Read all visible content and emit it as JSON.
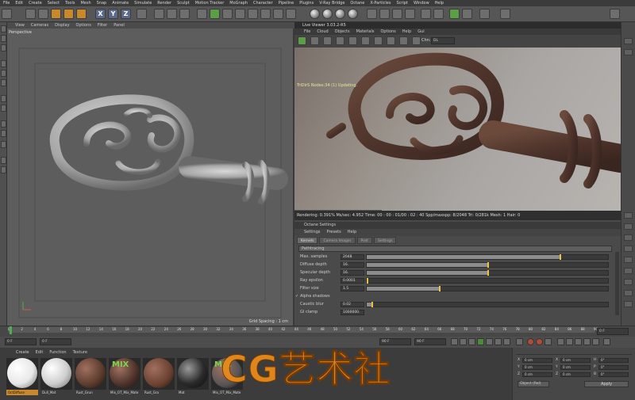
{
  "menubar": [
    "File",
    "Edit",
    "Create",
    "Select",
    "Tools",
    "Mesh",
    "Snap",
    "Animate",
    "Simulate",
    "Render",
    "Sculpt",
    "Motion Tracker",
    "MoGraph",
    "Character",
    "Pipeline",
    "Plugins",
    "V-Ray Bridge",
    "Octane",
    "X-Particles",
    "Script",
    "Window",
    "Help"
  ],
  "toolbar": {
    "x_label": "X",
    "y_label": "Y",
    "z_label": "Z"
  },
  "viewport": {
    "menu": [
      "View",
      "Cameras",
      "Display",
      "Options",
      "Filter",
      "Panel"
    ],
    "label": "Perspective",
    "grid_spacing": "Grid Spacing : 1 cm"
  },
  "liveviewer": {
    "title": "Live Viewer 3.03.2-R5",
    "menu": [
      "File",
      "Cloud",
      "Objects",
      "Materials",
      "Options",
      "Help",
      "Gui"
    ],
    "channel_label": "Chn:",
    "channel_value": "DL",
    "status": "TriDirS Nodes:34 (1) Updating.",
    "gpu": {
      "name": "GTX 980M[T1]",
      "mem": "9/80",
      "temp": "64°C",
      "line1": "Out-of-core used/max:0Kb/4Gb",
      "line2": "Grey8/16: 2/0",
      "line2b": "Rgb32/64: 0/1",
      "line3": "Used/free/total vram: 748Mb/721Mb/2Gb"
    },
    "gpu_buttons": [
      "Light",
      "DIFF"
    ],
    "statusbar": "Rendering: 0.391%    Ms/sec: 4.952    Time: 00 : 00 : 01/00 : 02 : 40    Spp/maxspp: 8/2048    Tri: 0/281k    Mesh: 1    Hair: 0"
  },
  "octane": {
    "title": "Octane Settings",
    "menu": [
      "Settings",
      "Presets",
      "Help"
    ],
    "tabs": [
      "Kernels",
      "Camera Imager",
      "Post",
      "Settings"
    ],
    "kernel": "Pathtracing",
    "params": [
      {
        "label": "Max. samples",
        "value": "2048",
        "fill": 0.8
      },
      {
        "label": "Diffuse depth",
        "value": "16.",
        "fill": 0.5
      },
      {
        "label": "Specular depth",
        "value": "16.",
        "fill": 0.5
      },
      {
        "label": "Ray epsilon",
        "value": "0.0001",
        "fill": 0.0
      },
      {
        "label": "Filter size",
        "value": "1.5",
        "fill": 0.3
      },
      {
        "label": "Alpha shadows",
        "value": "",
        "fill": -1
      },
      {
        "label": "Caustic blur",
        "value": "0.02",
        "fill": 0.02
      },
      {
        "label": "GI clamp",
        "value": "1000000.",
        "fill": -1
      }
    ]
  },
  "timeline": {
    "ticks": [
      "0",
      "2",
      "4",
      "6",
      "8",
      "10",
      "12",
      "14",
      "16",
      "18",
      "20",
      "22",
      "24",
      "26",
      "28",
      "30",
      "32",
      "34",
      "36",
      "38",
      "40",
      "42",
      "44",
      "46",
      "48",
      "50",
      "52",
      "54",
      "56",
      "58",
      "60",
      "62",
      "64",
      "66",
      "68",
      "70",
      "72",
      "74",
      "76",
      "78",
      "80",
      "82",
      "84",
      "86",
      "88",
      "90"
    ],
    "frame_end": "0 F",
    "start_field": "0 F",
    "field2": "0 F",
    "field3": "90 F",
    "field4": "90 F"
  },
  "materials": {
    "menu": [
      "Create",
      "Edit",
      "Function",
      "Texture"
    ],
    "items": [
      {
        "name": "OctDiffuse",
        "color": "#e8e8e8",
        "type": "white",
        "selected": true
      },
      {
        "name": "Dull_Mat",
        "color": "#cfcfcf",
        "type": "white",
        "selected": false
      },
      {
        "name": "Rust_Grun",
        "color": "#5a3a2c",
        "type": "rust",
        "selected": false
      },
      {
        "name": "Mix_OT_Mix_Mate",
        "color": "#4a3028",
        "type": "mix",
        "selected": false
      },
      {
        "name": "Rust_Gra",
        "color": "#6a4030",
        "type": "rust",
        "selected": false
      },
      {
        "name": "Mat",
        "color": "#2a2a2a",
        "type": "dark",
        "selected": false
      },
      {
        "name": "Mix_OT_Mix_Mate",
        "color": "#555",
        "type": "mix",
        "selected": false
      }
    ]
  },
  "watermark": "CG艺术社",
  "attributes": {
    "rows": [
      {
        "l1": "X",
        "v1": "0 cm",
        "l2": "X",
        "v2": "0 cm",
        "l3": "H",
        "v3": "0°"
      },
      {
        "l1": "Y",
        "v1": "0 cm",
        "l2": "Y",
        "v2": "0 cm",
        "l3": "P",
        "v3": "0°"
      },
      {
        "l1": "Z",
        "v1": "0 cm",
        "l2": "Z",
        "v2": "0 cm",
        "l3": "B",
        "v3": "0°"
      }
    ],
    "world": "Object (Rel)",
    "size": "Size",
    "apply": "Apply"
  },
  "colors": {
    "accent": "#e8c340",
    "watermark": "#e88a1a",
    "mix": "#7bd34a"
  }
}
